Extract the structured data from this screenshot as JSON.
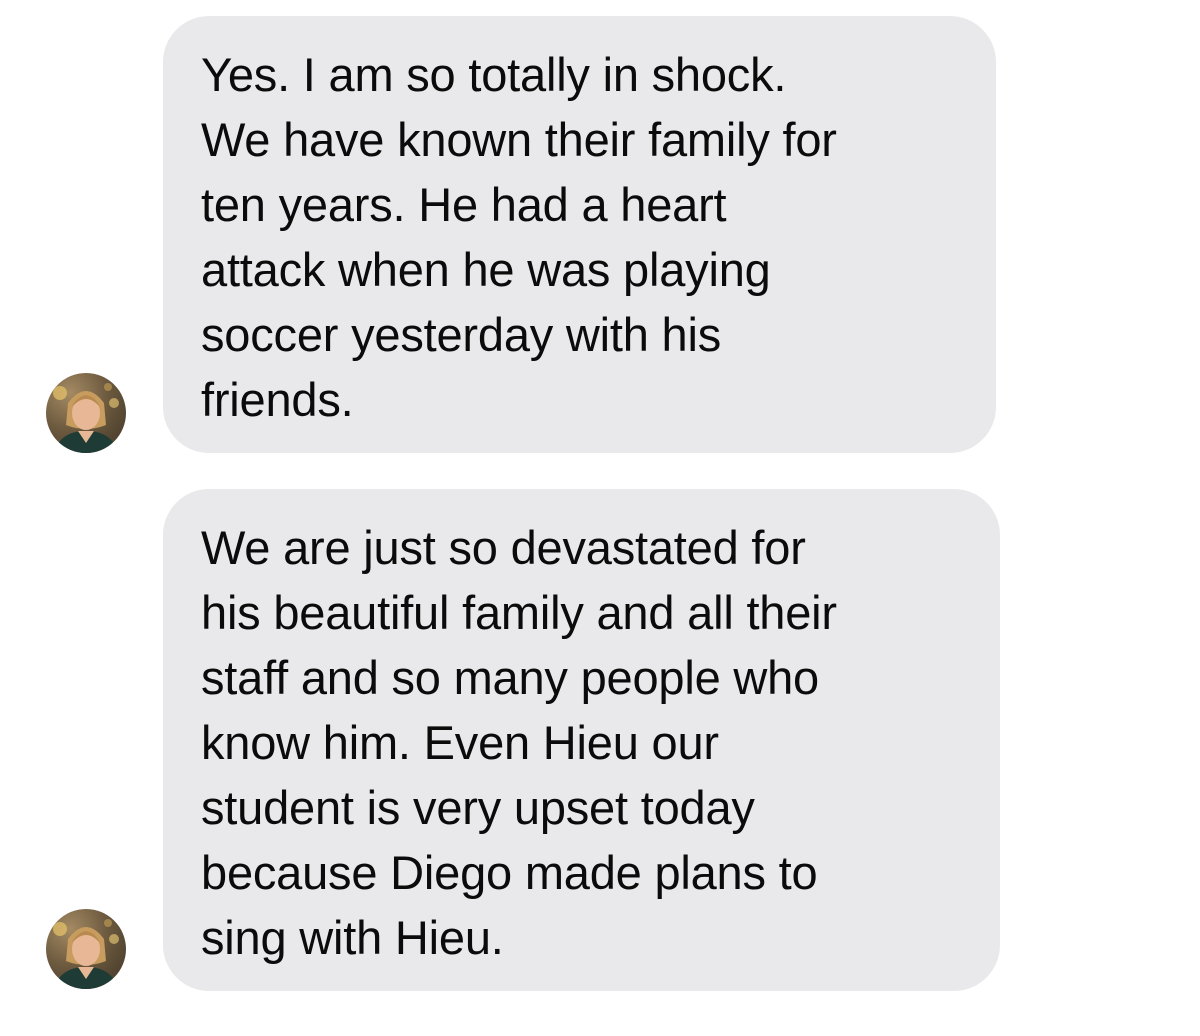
{
  "conversation": {
    "messages": [
      {
        "sender": "other",
        "avatar_icon": "contact-avatar",
        "lines": [
          "Yes. I am so totally in shock.",
          "We have known their family for",
          "ten years. He had a heart",
          "attack when he was playing",
          "soccer yesterday with his",
          "friends."
        ]
      },
      {
        "sender": "other",
        "avatar_icon": "contact-avatar",
        "lines": [
          "We are just so devastated for",
          "his beautiful family and all their",
          "staff and so many people who",
          "know him. Even Hieu our",
          "student is very upset today",
          "because Diego made plans to",
          "sing with Hieu."
        ]
      }
    ]
  },
  "colors": {
    "background": "#ffffff",
    "bubble_received": "#e9e9eb",
    "text": "#0b0b0b"
  }
}
